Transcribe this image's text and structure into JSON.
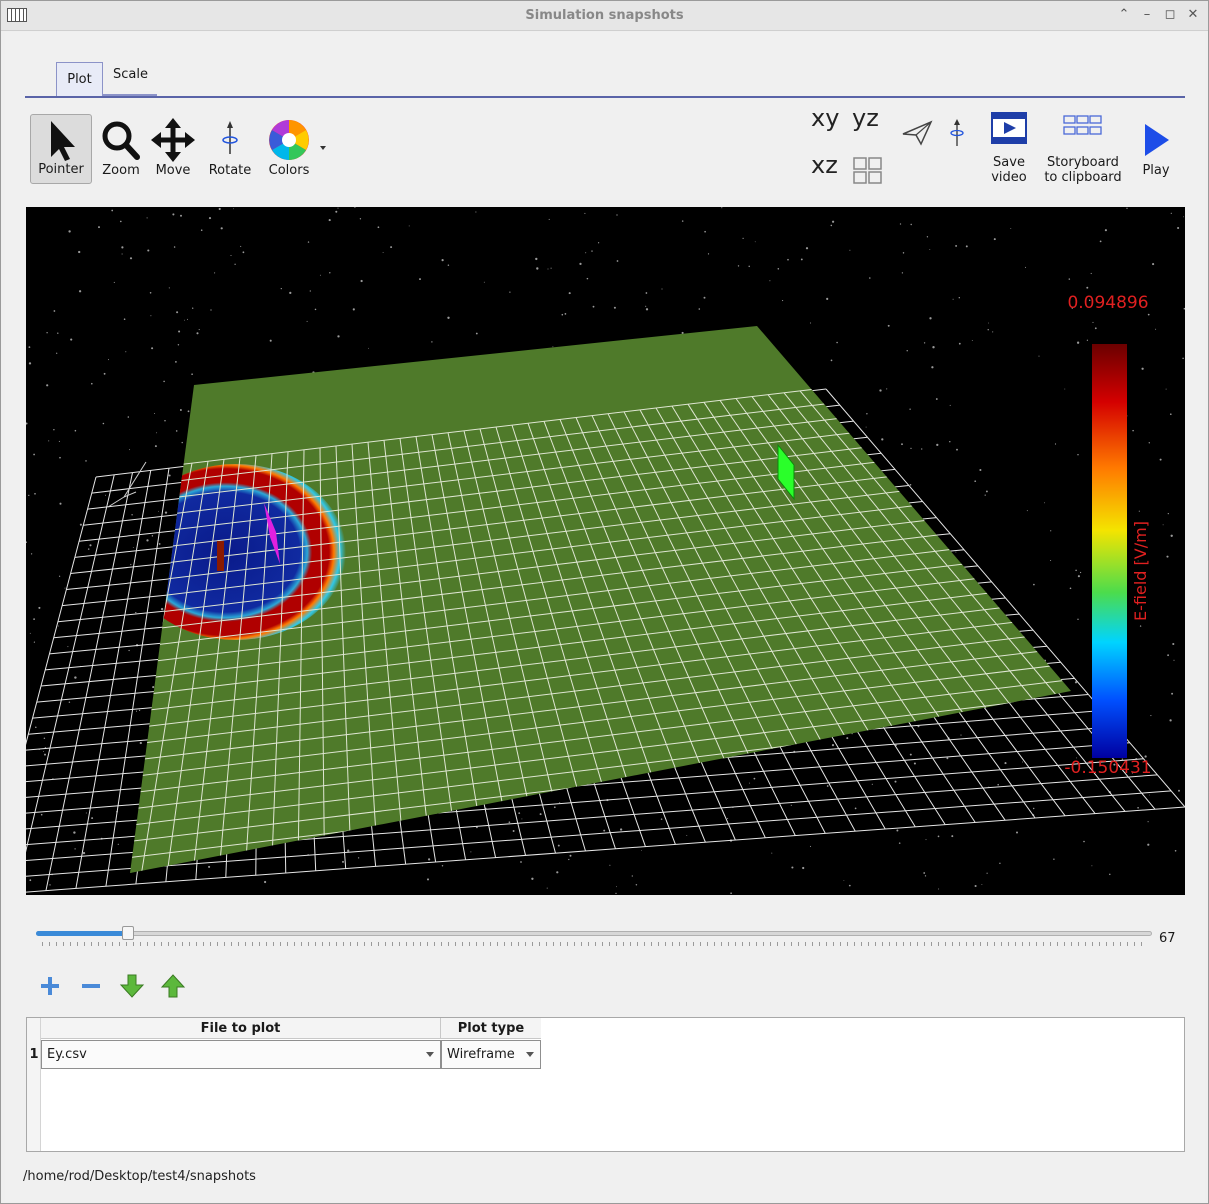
{
  "window": {
    "title": "Simulation snapshots"
  },
  "tabs": [
    {
      "label": "Plot",
      "active": true
    },
    {
      "label": "Scale",
      "active": false
    }
  ],
  "toolbar": {
    "pointer": "Pointer",
    "zoom": "Zoom",
    "move": "Move",
    "rotate": "Rotate",
    "colors": "Colors",
    "view_xy": "xy",
    "view_yz": "yz",
    "view_xz": "xz",
    "save_video_line1": "Save",
    "save_video_line2": "video",
    "storyboard_line1": "Storyboard",
    "storyboard_line2": "to clipboard",
    "play": "Play"
  },
  "plot": {
    "colorbar_max": "0.094896",
    "colorbar_min": "-0.150431",
    "colorbar_label": "E-field [V/m]",
    "colorbar_colors": [
      "#6b0000",
      "#d40000",
      "#ff7a00",
      "#f4e400",
      "#4cdc4c",
      "#00d4ff",
      "#0050ff",
      "#0000a0"
    ]
  },
  "timeline": {
    "value": "67",
    "fraction": 0.082
  },
  "table": {
    "columns": [
      "File to plot",
      "Plot type"
    ],
    "rows": [
      {
        "index": "1",
        "file": "Ey.csv",
        "type": "Wireframe"
      }
    ]
  },
  "status": {
    "path": "/home/rod/Desktop/test4/snapshots"
  }
}
